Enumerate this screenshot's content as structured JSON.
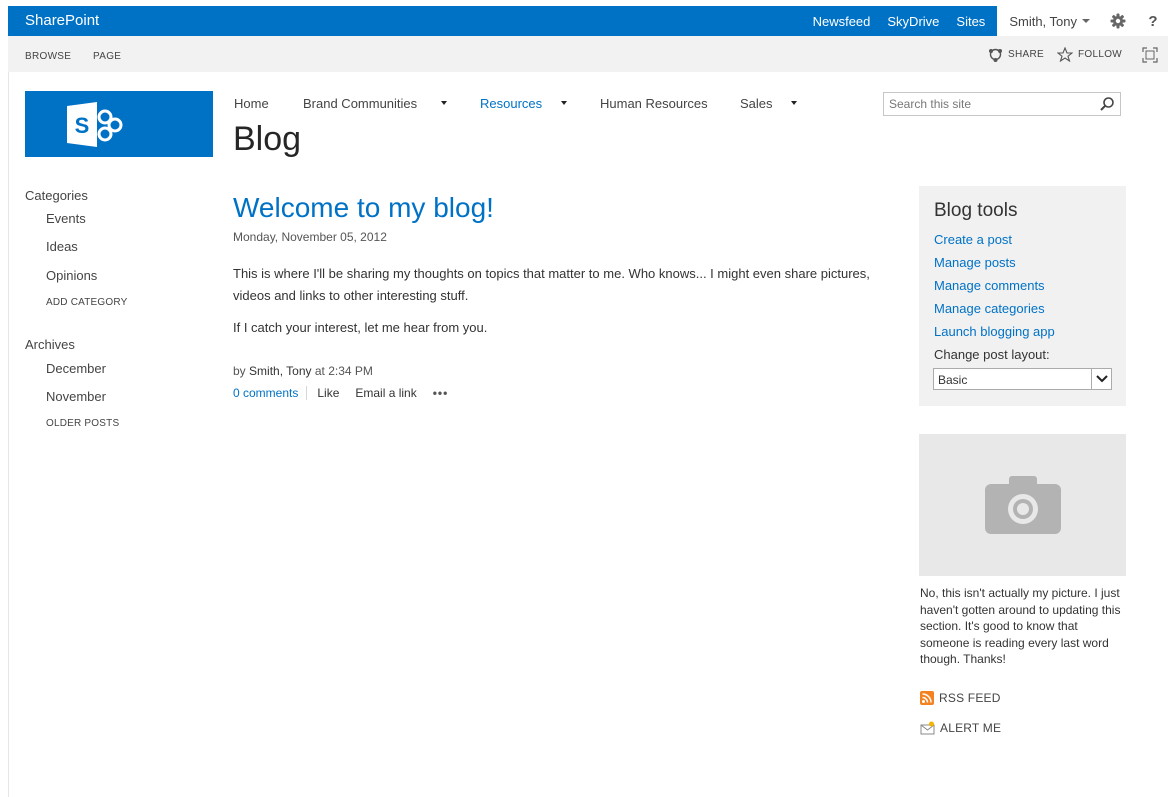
{
  "suite_bar": {
    "brand": "SharePoint",
    "links": [
      "Newsfeed",
      "SkyDrive",
      "Sites"
    ],
    "user": "Smith, Tony",
    "help": "?"
  },
  "ribbon": {
    "tabs": [
      "BROWSE",
      "PAGE"
    ],
    "share": "SHARE",
    "follow": "FOLLOW"
  },
  "top_nav": {
    "items": [
      {
        "label": "Home",
        "has_menu": false,
        "active": false
      },
      {
        "label": "Brand Communities",
        "has_menu": true,
        "active": false
      },
      {
        "label": "Resources",
        "has_menu": true,
        "active": true
      },
      {
        "label": "Human Resources",
        "has_menu": false,
        "active": false
      },
      {
        "label": "Sales",
        "has_menu": true,
        "active": false
      }
    ],
    "search_placeholder": "Search this site"
  },
  "page_title": "Blog",
  "left_nav": {
    "categories_heading": "Categories",
    "categories": [
      "Events",
      "Ideas",
      "Opinions"
    ],
    "add_category": "ADD CATEGORY",
    "archives_heading": "Archives",
    "archives": [
      "December",
      "November"
    ],
    "older_posts": "OLDER POSTS"
  },
  "post": {
    "title": "Welcome to my blog!",
    "date": "Monday, November 05, 2012",
    "paragraphs": [
      "This is where I'll be sharing my thoughts on topics that matter to me. Who knows... I might even share pictures, videos and links to other interesting stuff.",
      "If I catch your interest, let me hear from you."
    ],
    "by_prefix": "by",
    "author": "Smith, Tony",
    "time": "at 2:34 PM",
    "comments": "0 comments",
    "like": "Like",
    "email": "Email a link",
    "more": "•••"
  },
  "blog_tools": {
    "title": "Blog tools",
    "links": [
      "Create a post",
      "Manage posts",
      "Manage comments",
      "Manage categories",
      "Launch blogging app"
    ],
    "layout_label": "Change post layout:",
    "layout_value": "Basic"
  },
  "sidebar": {
    "caption": "No, this isn't actually my picture. I just haven't gotten around to updating this section. It's good to know that someone is reading every last word though. Thanks!",
    "rss": "RSS FEED",
    "alert": "ALERT ME"
  },
  "colors": {
    "accent": "#0072c6",
    "ribbon": "#f2f2f2",
    "panel": "#f1f1f1"
  },
  "icons": [
    "gear-icon",
    "share-icon",
    "star-icon",
    "focus-icon",
    "search-icon",
    "camera-icon",
    "rss-icon",
    "alert-icon",
    "sharepoint-logo"
  ]
}
